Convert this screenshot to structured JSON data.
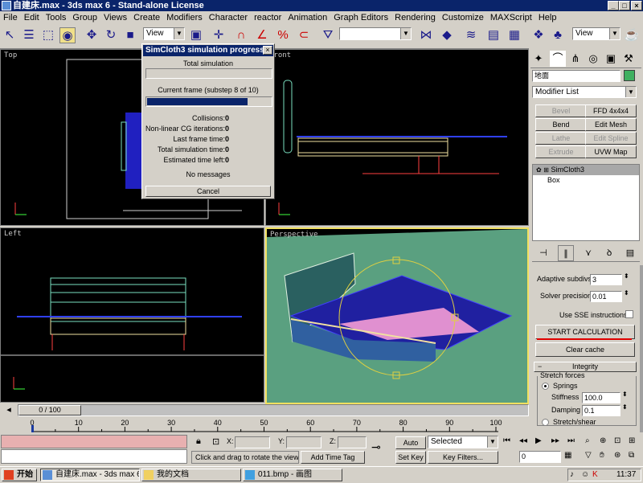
{
  "window": {
    "title": "自建床.max - 3ds max 6 - Stand-alone License"
  },
  "menu": [
    "File",
    "Edit",
    "Tools",
    "Group",
    "Views",
    "Create",
    "Modifiers",
    "Character",
    "reactor",
    "Animation",
    "Graph Editors",
    "Rendering",
    "Customize",
    "MAXScript",
    "Help"
  ],
  "toolbar": {
    "view_select_1": "View",
    "view_select_2": "View",
    "named_selection": ""
  },
  "viewports": {
    "top": "Top",
    "front": "Front",
    "left": "Left",
    "perspective": "Perspective"
  },
  "dialog": {
    "title": "SimCloth3 simulation progress",
    "total_label": "Total simulation",
    "current_label": "Current frame (substep 8 of 10)",
    "current_progress": 0.8,
    "stats": [
      {
        "label": "Collisions:",
        "value": "0"
      },
      {
        "label": "Non-linear CG iterations:",
        "value": "0"
      },
      {
        "label": "Last frame time:",
        "value": "0"
      },
      {
        "label": "Total simulation time:",
        "value": "0"
      },
      {
        "label": "Estimated time left:",
        "value": "0"
      }
    ],
    "messages": "No messages",
    "cancel": "Cancel"
  },
  "panel": {
    "object_name": "地面",
    "modifier_list": "Modifier List",
    "buttons": [
      {
        "label": "Bevel",
        "disabled": true
      },
      {
        "label": "FFD 4x4x4",
        "disabled": false
      },
      {
        "label": "Bend",
        "disabled": false
      },
      {
        "label": "Edit Mesh",
        "disabled": false
      },
      {
        "label": "Lathe",
        "disabled": true
      },
      {
        "label": "Edit Spline",
        "disabled": true
      },
      {
        "label": "Extrude",
        "disabled": true
      },
      {
        "label": "UVW Map",
        "disabled": false
      }
    ],
    "stack": [
      "SimCloth3",
      "Box"
    ],
    "adaptive_label": "Adaptive subdivs",
    "adaptive_value": "3",
    "solver_label": "Solver precision",
    "solver_value": "0.01",
    "sse_label": "Use SSE instructions",
    "start_calc": "START CALCULATION",
    "clear_cache": "Clear cache",
    "integrity": "Integrity",
    "stretch_forces": "Stretch forces",
    "springs": "Springs",
    "stiffness_label": "Stiffness",
    "stiffness_value": "100.0",
    "damping_label": "Damping",
    "damping_value": "0.1",
    "stretch_shear": "Stretch/shear"
  },
  "timeline": {
    "frame": "0 / 100",
    "ticks": [
      "0",
      "10",
      "20",
      "30",
      "40",
      "50",
      "60",
      "70",
      "80",
      "90",
      "100"
    ]
  },
  "status": {
    "prompt": "Click and drag to rotate the view.",
    "add_time_tag": "Add Time Tag",
    "x_label": "X:",
    "y_label": "Y:",
    "z_label": "Z:",
    "auto_key": "Auto Key",
    "set_key": "Set Key",
    "selected": "Selected",
    "key_filters": "Key Filters...",
    "frame_field": "0"
  },
  "taskbar": {
    "start": "开始",
    "tasks": [
      "自建床.max - 3ds max 6 ...",
      "我的文档",
      "011.bmp - 画图"
    ],
    "clock": "11:37"
  }
}
